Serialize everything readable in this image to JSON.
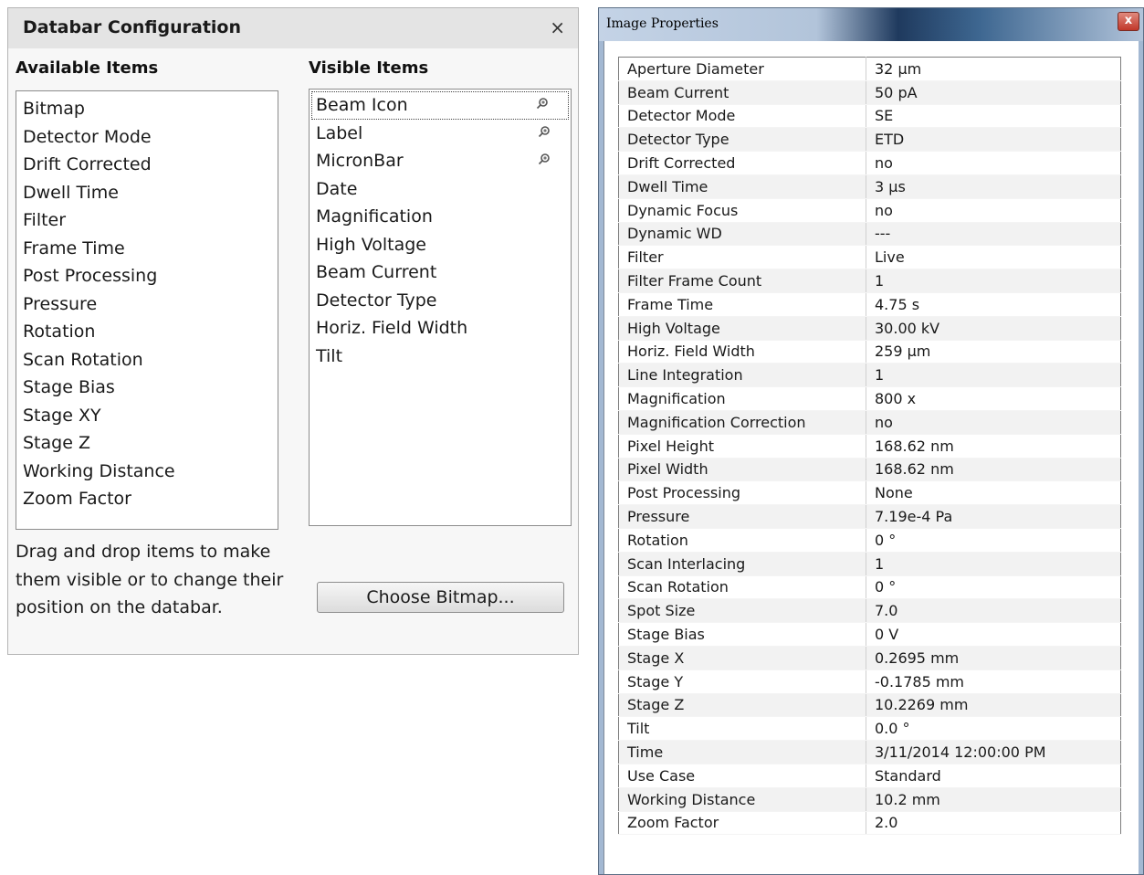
{
  "databar": {
    "title": "Databar Configuration",
    "close_glyph": "×",
    "available_header": "Available Items",
    "visible_header": "Visible Items",
    "available_items": [
      "Bitmap",
      "Detector Mode",
      "Drift Corrected",
      "Dwell Time",
      "Filter",
      "Frame Time",
      "Post Processing",
      "Pressure",
      "Rotation",
      "Scan Rotation",
      "Stage Bias",
      "Stage XY",
      "Stage Z",
      "Working Distance",
      "Zoom Factor"
    ],
    "visible_items": [
      {
        "label": "Beam Icon",
        "pinned": true,
        "focused": true
      },
      {
        "label": "Label",
        "pinned": true
      },
      {
        "label": "MicronBar",
        "pinned": true
      },
      {
        "label": "Date"
      },
      {
        "label": "Magnification"
      },
      {
        "label": "High Voltage"
      },
      {
        "label": "Beam Current"
      },
      {
        "label": "Detector Type"
      },
      {
        "label": "Horiz. Field Width"
      },
      {
        "label": "Tilt"
      }
    ],
    "pin_icon": "pin-icon",
    "help_text": "Drag and drop items to make them visible or to change their position on the databar.",
    "choose_bitmap_label": "Choose Bitmap..."
  },
  "image_properties": {
    "title": "Image Properties",
    "close_glyph": "x",
    "rows": [
      [
        "Aperture Diameter",
        "32 µm"
      ],
      [
        "Beam Current",
        "50 pA"
      ],
      [
        "Detector Mode",
        "SE"
      ],
      [
        "Detector Type",
        "ETD"
      ],
      [
        "Drift Corrected",
        "no"
      ],
      [
        "Dwell Time",
        "3 µs"
      ],
      [
        "Dynamic Focus",
        "no"
      ],
      [
        "Dynamic WD",
        "---"
      ],
      [
        "Filter",
        "Live"
      ],
      [
        "Filter Frame Count",
        "1"
      ],
      [
        "Frame Time",
        "4.75 s"
      ],
      [
        "High Voltage",
        "30.00 kV"
      ],
      [
        "Horiz. Field Width",
        "259 µm"
      ],
      [
        "Line Integration",
        "1"
      ],
      [
        "Magnification",
        "800 x"
      ],
      [
        "Magnification Correction",
        "no"
      ],
      [
        "Pixel Height",
        "168.62 nm"
      ],
      [
        "Pixel Width",
        "168.62 nm"
      ],
      [
        "Post Processing",
        "None"
      ],
      [
        "Pressure",
        "7.19e-4 Pa"
      ],
      [
        "Rotation",
        "0 °"
      ],
      [
        "Scan Interlacing",
        "1"
      ],
      [
        "Scan Rotation",
        "0 °"
      ],
      [
        "Spot Size",
        "7.0"
      ],
      [
        "Stage Bias",
        "0 V"
      ],
      [
        "Stage X",
        "0.2695 mm"
      ],
      [
        "Stage Y",
        "-0.1785 mm"
      ],
      [
        "Stage Z",
        "10.2269 mm"
      ],
      [
        "Tilt",
        "0.0 °"
      ],
      [
        "Time",
        "3/11/2014 12:00:00 PM"
      ],
      [
        "Use Case",
        "Standard"
      ],
      [
        "Working Distance",
        "10.2 mm"
      ],
      [
        "Zoom Factor",
        "2.0"
      ]
    ]
  }
}
